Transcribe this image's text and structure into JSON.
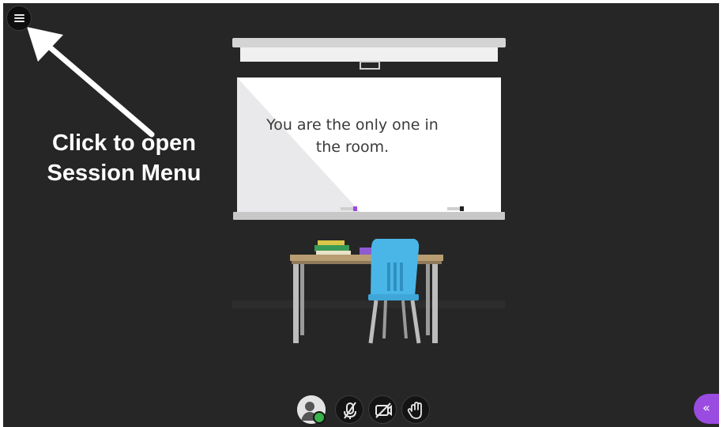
{
  "board": {
    "message": "You are the only one in the room."
  },
  "annotation": {
    "line1": "Click to open",
    "line2": "Session Menu"
  },
  "icons": {
    "session_menu": "hamburger-menu-icon",
    "avatar": "user-avatar-icon",
    "microphone": "microphone-muted-icon",
    "camera": "camera-off-icon",
    "hand": "raise-hand-icon",
    "collaborate_panel": "double-chevron-left-icon"
  },
  "colors": {
    "background": "#262626",
    "accent_purple": "#9a4be0",
    "status_green": "#38b24a",
    "chair_blue": "#4ab6e8"
  }
}
